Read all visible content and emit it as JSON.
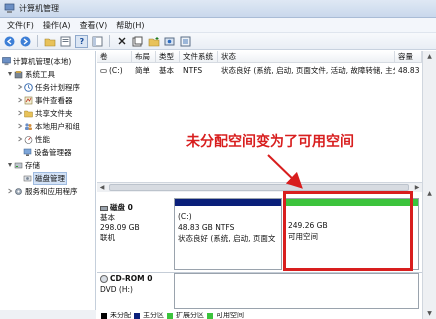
{
  "window": {
    "title": "计算机管理"
  },
  "menu": [
    {
      "label": "文件(F)"
    },
    {
      "label": "操作(A)"
    },
    {
      "label": "查看(V)"
    },
    {
      "label": "帮助(H)"
    }
  ],
  "toolbar": {
    "buttons": [
      "back-icon",
      "forward-icon",
      "up-folder-icon",
      "properties-icon",
      "help-icon",
      "show-tree-icon",
      "delete-icon",
      "properties-sheet-icon",
      "new-folder-icon",
      "find-icon",
      "zoom-icon"
    ]
  },
  "tree": {
    "root": "计算机管理(本地)",
    "system_tools": "系统工具",
    "task_scheduler": "任务计划程序",
    "event_viewer": "事件查看器",
    "shared_folders": "共享文件夹",
    "local_users": "本地用户和组",
    "performance": "性能",
    "device_manager": "设备管理器",
    "storage": "存储",
    "disk_management": "磁盘管理",
    "services_apps": "服务和应用程序"
  },
  "volume_list": {
    "columns": [
      "卷",
      "布局",
      "类型",
      "文件系统",
      "状态",
      "容量"
    ],
    "row": {
      "volume": "(C:)",
      "layout": "简单",
      "type": "基本",
      "fs": "NTFS",
      "status": "状态良好 (系统, 启动, 页面文件, 活动, 故障转储, 主分区)",
      "capacity": "48.83 G"
    }
  },
  "disk0": {
    "name": "磁盘 0",
    "type": "基本",
    "size": "298.09 GB",
    "status": "联机",
    "partition_c": {
      "name": "(C:)",
      "size_fs": "48.83 GB NTFS",
      "status": "状态良好 (系统, 启动, 页面文"
    },
    "free": {
      "size": "249.26 GB",
      "label": "可用空间"
    }
  },
  "cdrom": {
    "name": "CD-ROM 0",
    "drive": "DVD (H:)"
  },
  "annotation": {
    "text": "未分配空间变为了可用空间"
  },
  "legend": [
    {
      "label": "未分配",
      "color": "#000000"
    },
    {
      "label": "主分区",
      "color": "#0a1f7a"
    },
    {
      "label": "扩展分区",
      "color": "#3cc33c"
    },
    {
      "label": "可用空间",
      "color": "#3cc33c"
    }
  ],
  "colors": {
    "primary_partition": "#0a1f7a",
    "free_space": "#3cc33c",
    "highlight": "#d81e1e"
  }
}
